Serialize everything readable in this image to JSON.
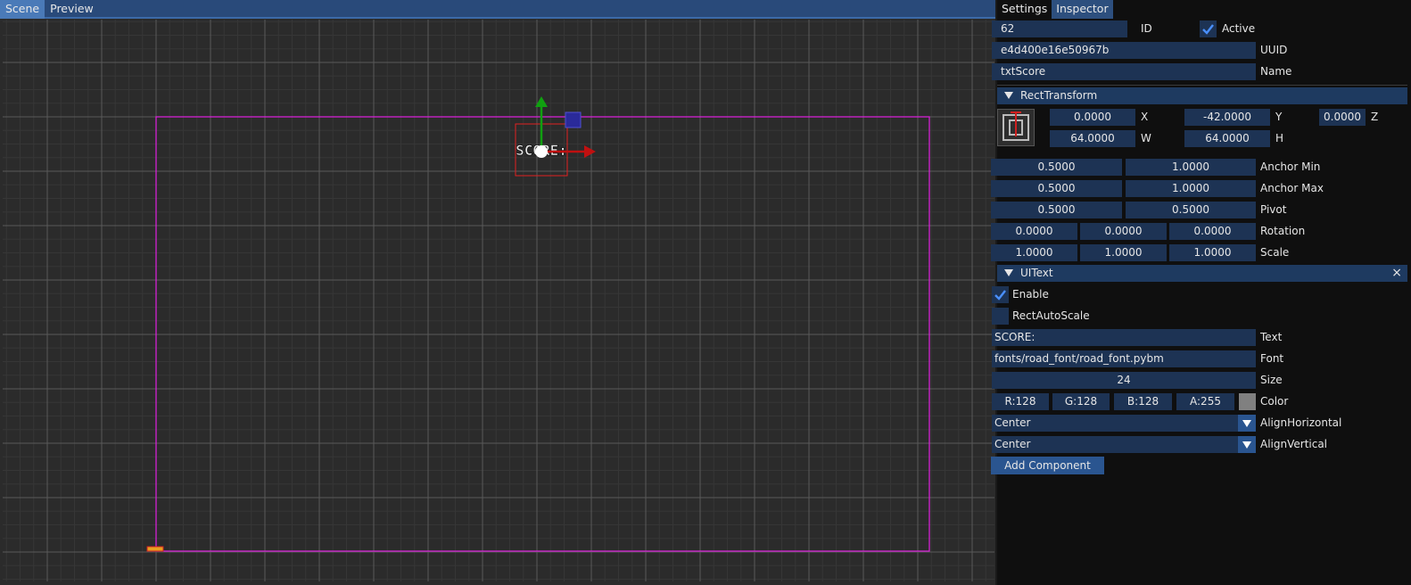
{
  "scene": {
    "tabs": [
      {
        "label": "Scene",
        "active": true
      },
      {
        "label": "Preview",
        "active": false
      }
    ],
    "object_label": "SCORE:",
    "colors": {
      "background": "#2b2b2b",
      "grid_major": "#5a5a5a",
      "grid_minor": "#363636",
      "canvas_rect": "#e020e0",
      "selection_rect": "#e02020",
      "gizmo_y": "#10a010",
      "gizmo_x": "#c01010",
      "gizmo_handle": "#2a2a9a"
    }
  },
  "inspector": {
    "tabs": [
      {
        "label": "Settings",
        "active": false
      },
      {
        "label": "Inspector",
        "active": true
      }
    ],
    "id": {
      "value": "62",
      "label": "ID"
    },
    "active": {
      "checked": true,
      "label": "Active"
    },
    "uuid": {
      "value": "e4d400e16e50967b",
      "label": "UUID"
    },
    "name": {
      "value": "txtScore",
      "label": "Name"
    },
    "rect_transform": {
      "title": "RectTransform",
      "x": {
        "value": "0.0000",
        "label": "X"
      },
      "y": {
        "value": "-42.0000",
        "label": "Y"
      },
      "z": {
        "value": "0.0000",
        "label": "Z"
      },
      "w": {
        "value": "64.0000",
        "label": "W"
      },
      "h": {
        "value": "64.0000",
        "label": "H"
      },
      "anchor_min": {
        "values": [
          "0.5000",
          "1.0000"
        ],
        "label": "Anchor Min"
      },
      "anchor_max": {
        "values": [
          "0.5000",
          "1.0000"
        ],
        "label": "Anchor Max"
      },
      "pivot": {
        "values": [
          "0.5000",
          "0.5000"
        ],
        "label": "Pivot"
      },
      "rotation": {
        "values": [
          "0.0000",
          "0.0000",
          "0.0000"
        ],
        "label": "Rotation"
      },
      "scale": {
        "values": [
          "1.0000",
          "1.0000",
          "1.0000"
        ],
        "label": "Scale"
      }
    },
    "ui_text": {
      "title": "UIText",
      "close_icon": "×",
      "enable": {
        "checked": true,
        "label": "Enable"
      },
      "rect_auto_scale": {
        "checked": false,
        "label": "RectAutoScale"
      },
      "text": {
        "value": "SCORE:",
        "label": "Text"
      },
      "font": {
        "value": "fonts/road_font/road_font.pybm",
        "label": "Font"
      },
      "size": {
        "value": "24",
        "label": "Size"
      },
      "color": {
        "r": "R:128",
        "g": "G:128",
        "b": "B:128",
        "a": "A:255",
        "label": "Color",
        "swatch": "#808080"
      },
      "align_horizontal": {
        "value": "Center",
        "label": "AlignHorizontal"
      },
      "align_vertical": {
        "value": "Center",
        "label": "AlignVertical"
      }
    },
    "add_component_label": "Add Component"
  }
}
